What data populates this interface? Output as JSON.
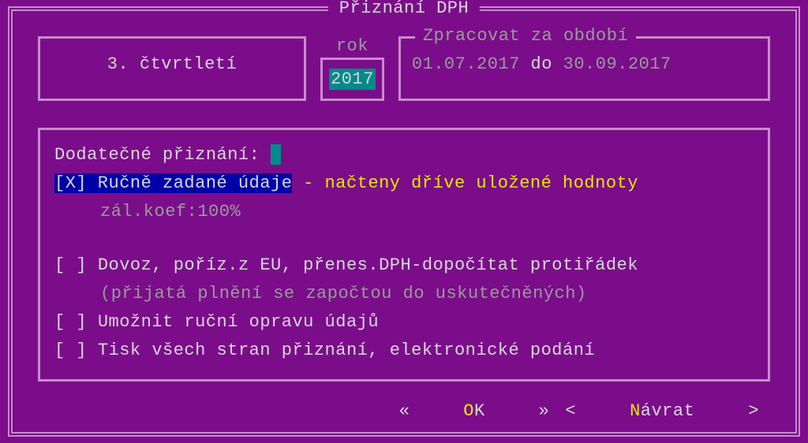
{
  "window": {
    "title": "Přiznání DPH"
  },
  "period": {
    "label": "3. čtvrtletí"
  },
  "year": {
    "label": "rok",
    "value": "2017"
  },
  "range": {
    "title": "Zpracovat za období",
    "from": "01.07.2017",
    "to_label": "do",
    "to": "30.09.2017"
  },
  "fields": {
    "additional_label": "Dodatečné přiznání:",
    "manual_check": "[X] Ručně zadané údaje",
    "manual_note": " - načteny dříve uložené hodnoty",
    "coef": "zál.koef:100%",
    "import_check": "[ ]",
    "import_label": "Dovoz, poříz.z EU, přenes.DPH-dopočítat protiřádek",
    "import_hint": "(přijatá plnění se započtou do uskutečněných)",
    "allow_check": "[ ]",
    "allow_label": "Umožnit ruční opravu údajů",
    "print_check": "[ ]",
    "print_label": "Tisk všech stran přiznání, elektronické podání"
  },
  "footer": {
    "prev_sym": "«",
    "ok_hot": "O",
    "ok_rest": "K",
    "next_sym": "»",
    "back_lt": "<",
    "back_hot": "N",
    "back_rest": "ávrat",
    "back_gt": ">"
  }
}
